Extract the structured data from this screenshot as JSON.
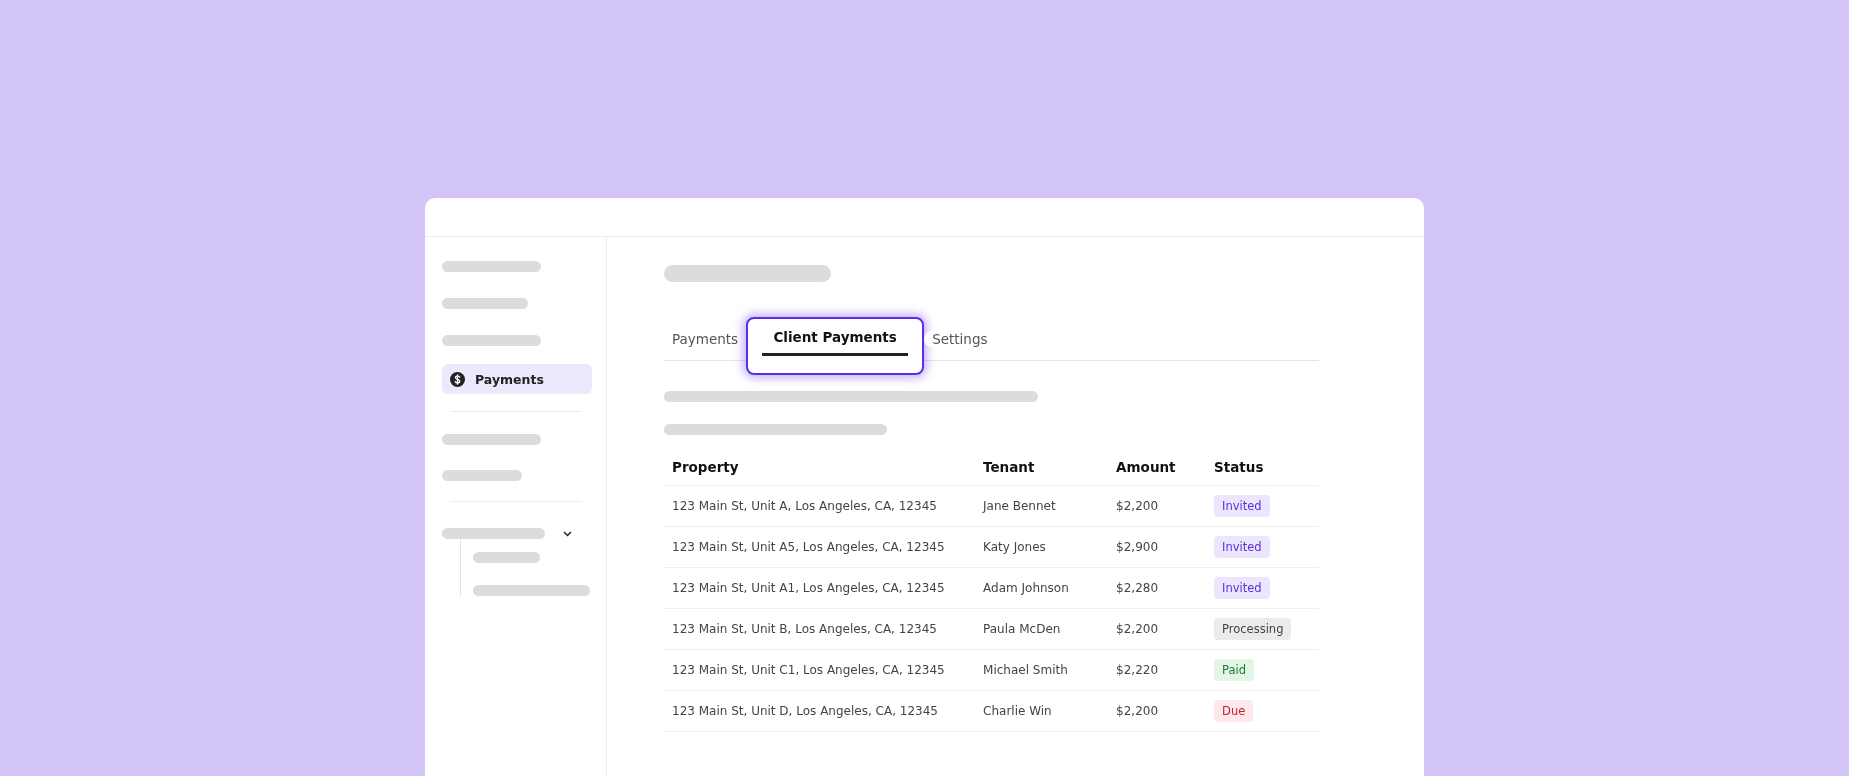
{
  "sidebar": {
    "items": [
      {
        "label": "Payments",
        "selected": true
      }
    ]
  },
  "tabs": [
    {
      "label": "Payments",
      "selected": false
    },
    {
      "label": "Client Payments",
      "selected": true
    },
    {
      "label": "Settings",
      "selected": false
    }
  ],
  "table": {
    "columns": [
      "Property",
      "Tenant",
      "Amount",
      "Status"
    ],
    "rows": [
      {
        "property": "123 Main St, Unit A, Los Angeles, CA, 12345",
        "tenant": "Jane Bennet",
        "amount": "$2,200",
        "status": {
          "label": "Invited",
          "kind": "invited"
        }
      },
      {
        "property": "123 Main St, Unit A5, Los Angeles, CA, 12345",
        "tenant": "Katy Jones",
        "amount": "$2,900",
        "status": {
          "label": "Invited",
          "kind": "invited"
        }
      },
      {
        "property": "123 Main St, Unit A1, Los Angeles, CA, 12345",
        "tenant": "Adam Johnson",
        "amount": "$2,280",
        "status": {
          "label": "Invited",
          "kind": "invited"
        }
      },
      {
        "property": "123 Main St, Unit B, Los Angeles, CA, 12345",
        "tenant": "Paula McDen",
        "amount": "$2,200",
        "status": {
          "label": "Processing",
          "kind": "processing"
        }
      },
      {
        "property": "123 Main St, Unit C1, Los Angeles, CA, 12345",
        "tenant": "Michael Smith",
        "amount": "$2,220",
        "status": {
          "label": "Paid",
          "kind": "paid"
        }
      },
      {
        "property": "123 Main St, Unit D, Los Angeles, CA, 12345",
        "tenant": "Charlie Win",
        "amount": "$2,200",
        "status": {
          "label": "Due",
          "kind": "due"
        }
      }
    ]
  }
}
